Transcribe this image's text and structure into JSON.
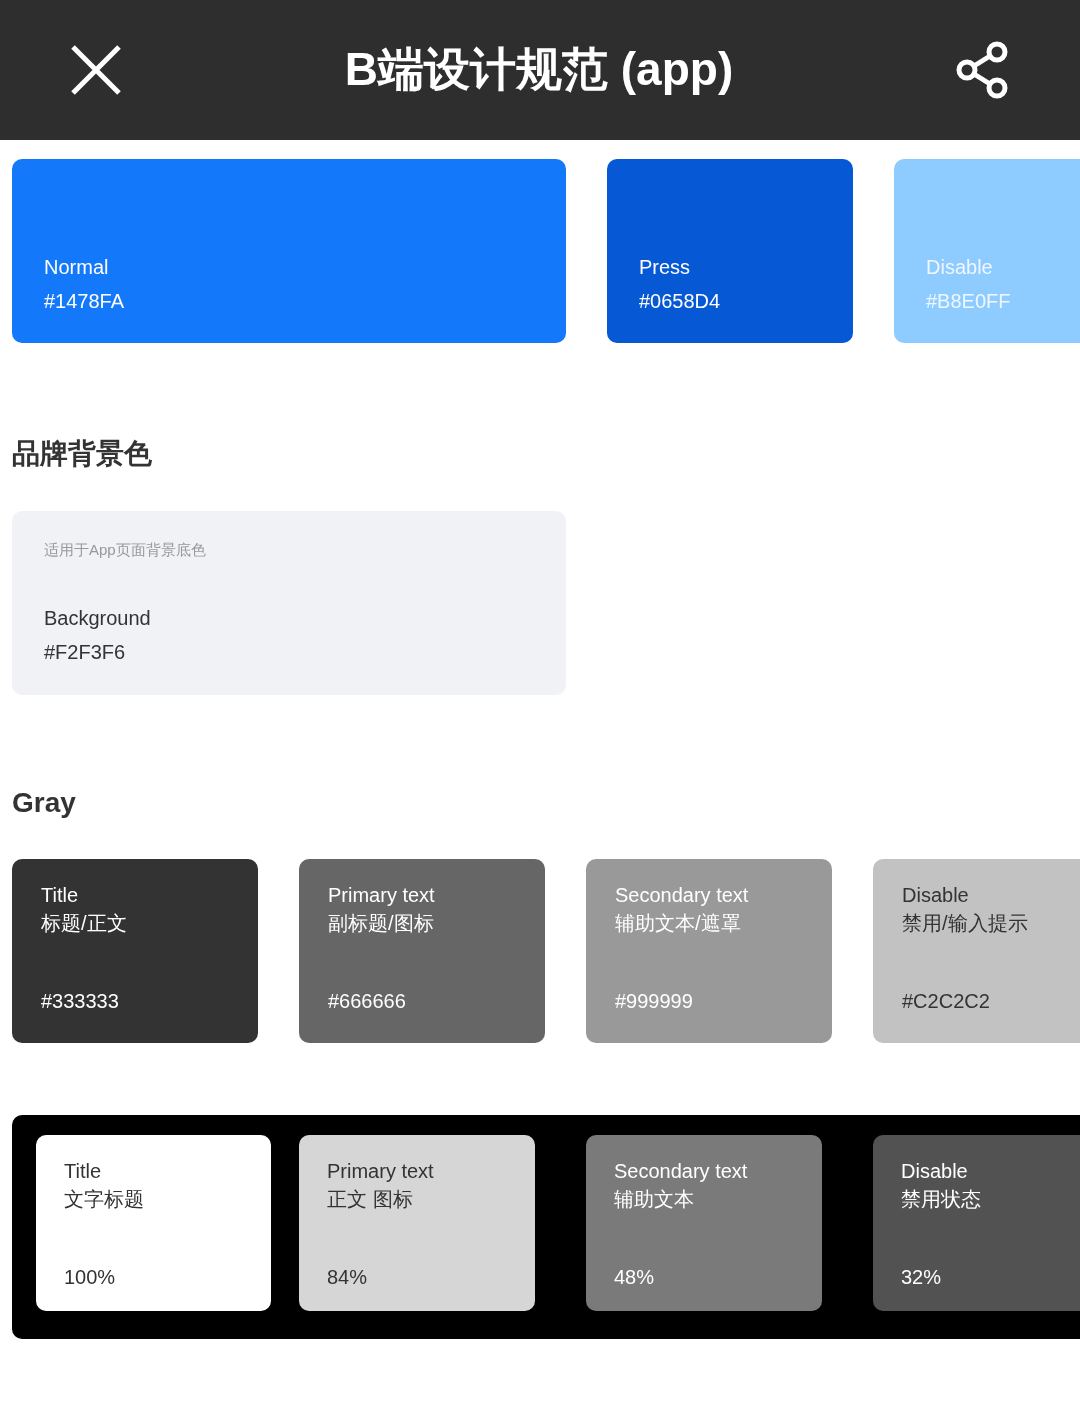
{
  "header": {
    "title": "B端设计规范 (app)"
  },
  "brand_swatches": [
    {
      "name": "Normal",
      "code": "#1478FA",
      "color": "#1478fa"
    },
    {
      "name": "Press",
      "code": "#0658D4",
      "color": "#0658d4"
    },
    {
      "name": "Disable",
      "code": "#B8E0FF",
      "color": "#8ecbff"
    }
  ],
  "background_section": {
    "heading": "品牌背景色",
    "note": "适用于App页面背景底色",
    "name": "Background",
    "code": "#F2F3F6",
    "color": "#f1f2f5"
  },
  "gray_section": {
    "heading": "Gray",
    "swatches": [
      {
        "name": "Title",
        "usage": "标题/正文",
        "code": "#333333",
        "color": "#333333"
      },
      {
        "name": "Primary text",
        "usage": "副标题/图标",
        "code": "#666666",
        "color": "#666666"
      },
      {
        "name": "Secondary text",
        "usage": "辅助文本/遮罩",
        "code": "#999999",
        "color": "#999999"
      },
      {
        "name": "Disable",
        "usage": "禁用/输入提示",
        "code": "#C2C2C2",
        "color": "#c2c2c2"
      }
    ]
  },
  "dark_swatches": [
    {
      "name": "Title",
      "usage": "文字标题",
      "code": "100%",
      "color": "#ffffff"
    },
    {
      "name": "Primary text",
      "usage": "正文 图标",
      "code": "84%",
      "color": "#d6d6d6"
    },
    {
      "name": "Secondary text",
      "usage": "辅助文本",
      "code": "48%",
      "color": "#7a7a7a"
    },
    {
      "name": "Disable",
      "usage": "禁用状态",
      "code": "32%",
      "color": "#525252"
    }
  ]
}
